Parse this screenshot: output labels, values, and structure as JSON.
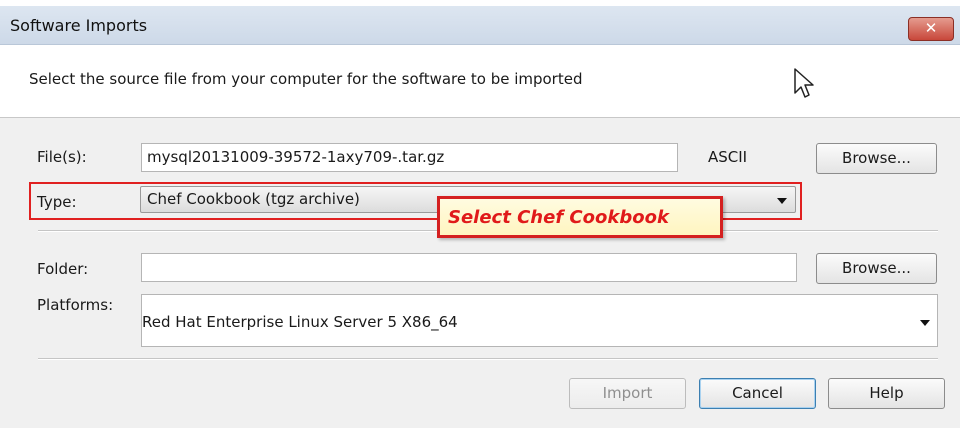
{
  "window": {
    "title": "Software Imports",
    "close_label": "✕"
  },
  "header": {
    "instruction": "Select the source file from your computer for the software to be imported"
  },
  "form": {
    "files_label": "File(s):",
    "files_value": "mysql20131009-39572-1axy709-.tar.gz",
    "encoding": "ASCII",
    "browse_label": "Browse...",
    "type_label": "Type:",
    "type_value": "Chef Cookbook (tgz archive)",
    "folder_label": "Folder:",
    "folder_value": "",
    "folder_browse_label": "Browse...",
    "platforms_label": "Platforms:",
    "platforms_value": "Red Hat Enterprise Linux Server 5 X86_64"
  },
  "callout": {
    "text": "Select Chef Cookbook",
    "color": "#e01a1a"
  },
  "footer": {
    "import_label": "Import",
    "cancel_label": "Cancel",
    "help_label": "Help"
  }
}
